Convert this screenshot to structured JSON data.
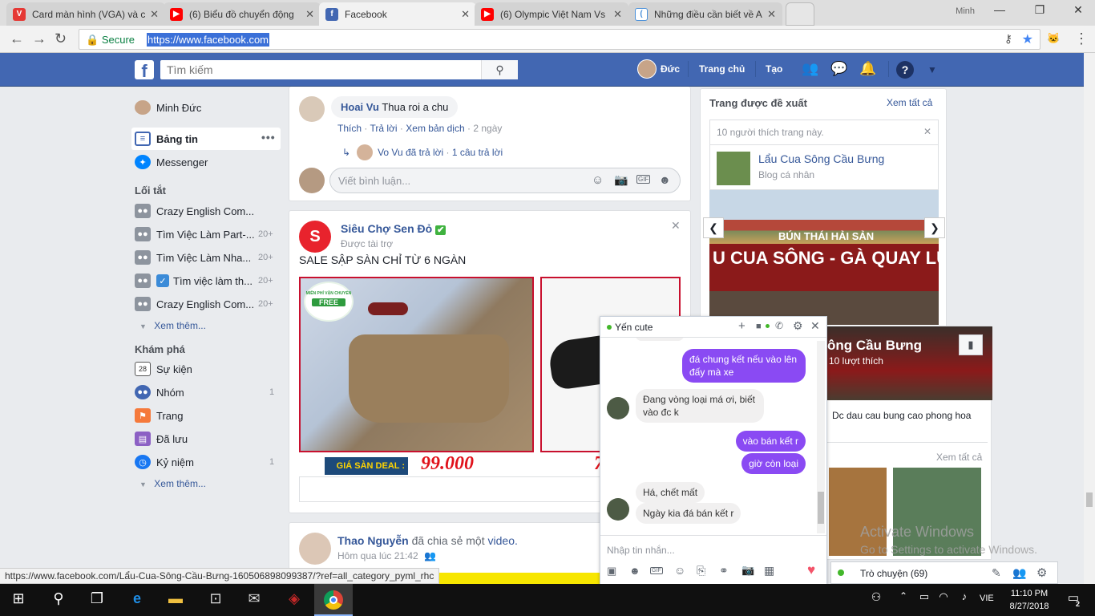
{
  "browser": {
    "tabs": [
      {
        "title": "Card màn hình (VGA) và c",
        "icon_color": "#e53935",
        "icon": "V"
      },
      {
        "title": "(6) Biểu đồ chuyển động",
        "icon_color": "#ff0000",
        "icon": "▶"
      },
      {
        "title": "Facebook",
        "icon_color": "#4267b2",
        "icon": "f"
      },
      {
        "title": "(6) Olympic Việt Nam Vs",
        "icon_color": "#ff0000",
        "icon": "▶"
      },
      {
        "title": "Những điều cần biết về A",
        "icon_color": "#4a90d9",
        "icon": "("
      }
    ],
    "window_user": "Minh",
    "secure_label": "Secure",
    "url": "https://www.facebook.com",
    "status_url": "https://www.facebook.com/Lẩu-Cua-Sông-Cầu-Bưng-160506898099387/?ref=all_category_pyml_rhc"
  },
  "fb": {
    "search_placeholder": "Tìm kiếm",
    "user_name": "Đức",
    "nav_home": "Trang chủ",
    "nav_create": "Tạo",
    "brand_color": "#4267b2"
  },
  "left": {
    "profile_name": "Minh Đức",
    "news_feed": "Bảng tin",
    "messenger": "Messenger",
    "shortcuts_heading": "Lối tắt",
    "shortcuts": [
      {
        "label": "Crazy English Com...",
        "count": ""
      },
      {
        "label": "Tìm Việc Làm Part-...",
        "count": "20+"
      },
      {
        "label": "Tìm Việc Làm Nha...",
        "count": "20+"
      },
      {
        "label": "Tìm việc làm th...",
        "count": "20+"
      },
      {
        "label": "Crazy English Com...",
        "count": "20+"
      }
    ],
    "see_more": "Xem thêm...",
    "explore_heading": "Khám phá",
    "explore": [
      {
        "label": "Sự kiện",
        "count": ""
      },
      {
        "label": "Nhóm",
        "count": "1"
      },
      {
        "label": "Trang",
        "count": ""
      },
      {
        "label": "Đã lưu",
        "count": ""
      },
      {
        "label": "Kỷ niệm",
        "count": "1"
      }
    ],
    "see_more2": "Xem thêm..."
  },
  "feed": {
    "comment": {
      "author": "Hoai Vu",
      "text": "Thua roi a chu",
      "actions": [
        "Thích",
        "Trả lời",
        "Xem bản dịch"
      ],
      "time": "2 ngày",
      "reply_author_text": "Vo Vu đã trả lời",
      "reply_count": "1 câu trả lời",
      "input_placeholder": "Viết bình luận..."
    },
    "ad": {
      "page": "Siêu Chợ Sen Đỏ",
      "sponsored": "Được tài trợ",
      "text": "SALE SẬP SÀN CHỈ TỪ 6 NGÀN",
      "badge": "GIÁ SÀN DEAL :",
      "price": "99.000",
      "price2": "7",
      "free_ship_top": "MIỄN PHÍ VẬN CHUYỂN",
      "free_ship": "FREE"
    },
    "share": {
      "author": "Thao Nguyễn",
      "action": "đã chia sẻ một",
      "object": "video.",
      "time": "Hôm qua lúc 21:42"
    }
  },
  "right": {
    "heading": "Trang được đề xuất",
    "see_all": "Xem tất cả",
    "likes_note": "10 người thích trang này.",
    "page_name": "Lẩu Cua Sông Cầu Bưng",
    "page_type": "Blog cá nhân",
    "sign_line1": "BÚN THÁI HẢI SẢN",
    "sign_line2": "U CUA SÔNG - GÀ QUAY LÚ",
    "card_title": "ông Cầu Bưng",
    "card_likes": "10 lượt thích",
    "card_desc": "Dc dau cau bung cao phong hoa",
    "see_all2": "Xem tất cả"
  },
  "chat": {
    "name": "Yến cute",
    "messages": [
      {
        "dir": "out",
        "text": "đá chung kết nếu vào lên đấy mà xe"
      },
      {
        "dir": "in",
        "text": "Đang vòng loại má ơi, biết vào đc k"
      },
      {
        "dir": "out",
        "text": "vào bán kết r"
      },
      {
        "dir": "out",
        "text": "giờ còn loại"
      },
      {
        "dir": "in",
        "text": "Há, chết mất"
      },
      {
        "dir": "in",
        "text": "Ngày kia đá bán kết r"
      }
    ],
    "input_placeholder": "Nhập tin nhắn...",
    "sidebar_label": "Trò chuyện (69)",
    "accent": "#8a4af3"
  },
  "os": {
    "activate_title": "Activate Windows",
    "activate_sub": "Go to Settings to activate Windows.",
    "lang": "VIE",
    "time": "11:10 PM",
    "date": "8/27/2018"
  }
}
